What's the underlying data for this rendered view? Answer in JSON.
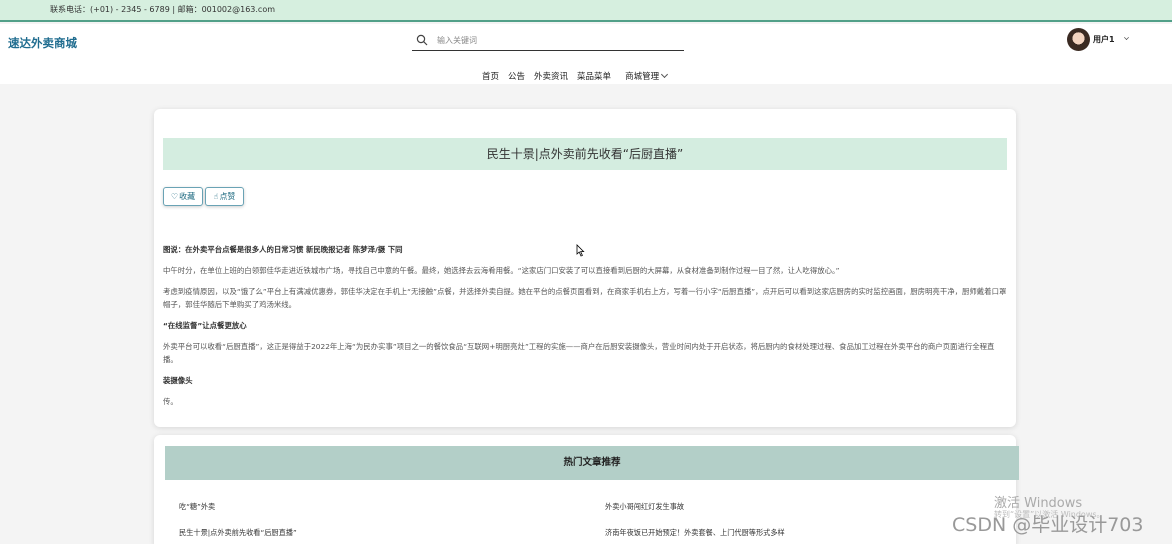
{
  "topbar": {
    "contact": "联系电话：(+01) - 2345 - 6789 | 邮箱：001002@163.com"
  },
  "header": {
    "brand": "速达外卖商城",
    "search_placeholder": "输入关键词",
    "user_name": "用户1",
    "nav": [
      "首页",
      "公告",
      "外卖资讯",
      "菜品菜单",
      "商城管理"
    ]
  },
  "article": {
    "title": "民生十景|点外卖前先收看“后厨直播”",
    "favorite_label": "收藏",
    "like_label": "点赞",
    "paragraphs": [
      {
        "text": "图说：在外卖平台点餐是很多人的日常习惯 新民晚报记者 陈梦泽/摄 下同",
        "bold": true
      },
      {
        "text": "中午时分，在单位上班的白领郭佳华走进近铁城市广场，寻找自己中意的午餐。最终，她选择去云海肴用餐。“这家店门口安装了可以直接看到后厨的大屏幕，从食材准备到制作过程一目了然，让人吃得放心。”",
        "bold": false
      },
      {
        "text": "考虑到疫情原因，以及“饿了么”平台上有满减优惠券，郭佳华决定在手机上“无接触”点餐，并选择外卖自提。她在平台的点餐页面看到，在商家手机右上方，写着一行小字“后厨直播”，点开后可以看到这家店厨房的实时监控画面，厨房明亮干净，厨师戴着口罩帽子，郭佳华随后下单购买了鸡汤米线。",
        "bold": false
      },
      {
        "text": "“在线监督”让点餐更放心",
        "bold": true
      },
      {
        "text": "外卖平台可以收看“后厨直播”，这正是得益于2022年上海“为民办实事”项目之一的餐饮食品“互联网+明厨亮灶”工程的实施——商户在后厨安装摄像头，营业时间内处于开启状态，将后厨内的食材处理过程、食品加工过程在外卖平台的商户页面进行全程直播。",
        "bold": false
      },
      {
        "text": "装摄像头",
        "bold": true
      },
      {
        "text": "传。",
        "bold": false
      }
    ]
  },
  "hot": {
    "heading": "热门文章推荐",
    "items": [
      "吃“糖”外卖",
      "外卖小哥闯红灯发生事故",
      "民生十景|点外卖前先收看“后厨直播”",
      "济南年夜饭已开始预定！外卖套餐、上门代厨等形式多样"
    ]
  },
  "overlay": {
    "windows_activate": "激活 Windows",
    "windows_hint": "转到“设置”以激活 Windows。",
    "csdn": "CSDN @毕业设计703"
  }
}
